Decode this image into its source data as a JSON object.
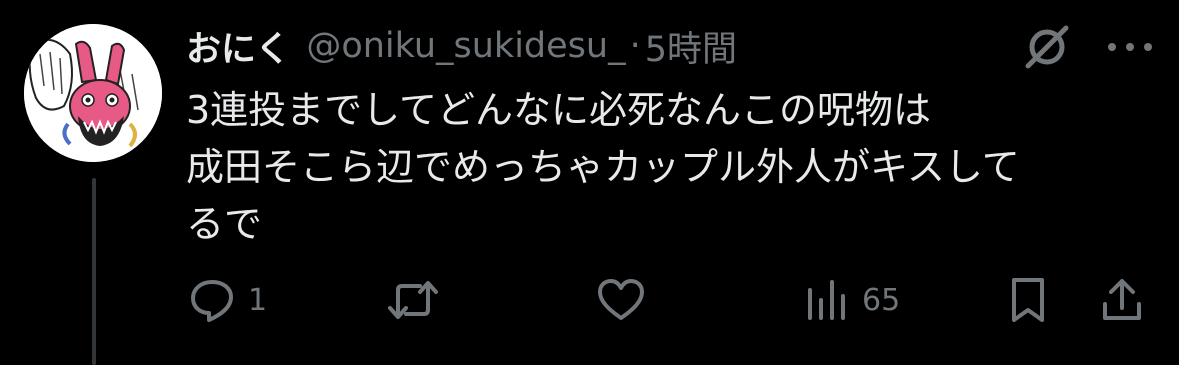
{
  "tweet": {
    "display_name": "おにく",
    "handle": "@oniku_sukidesu_",
    "separator": "·",
    "time": "5時間",
    "text_lines": [
      "3連投までしてどんなに必死なんこの呪物は",
      "成田そこら辺でめっちゃカップル外人がキスして",
      "るで"
    ]
  },
  "actions": {
    "reply_count": "1",
    "retweet_count": "",
    "like_count": "",
    "views_count": "65"
  },
  "icons": {
    "grok": "grok-icon",
    "more": "more-icon",
    "reply": "reply-icon",
    "retweet": "retweet-icon",
    "like": "heart-icon",
    "views": "views-icon",
    "bookmark": "bookmark-icon",
    "share": "share-icon"
  },
  "colors": {
    "background": "#000000",
    "primary_text": "#e7e9ea",
    "secondary_text": "#71767b",
    "thread_line": "#333639"
  }
}
